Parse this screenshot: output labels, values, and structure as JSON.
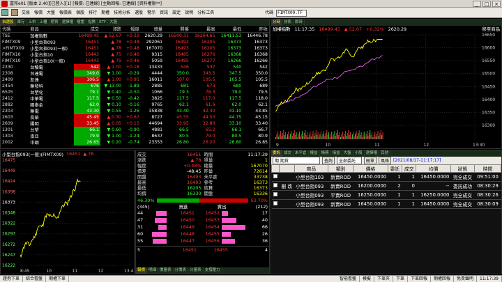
{
  "window": {
    "title": "富邦e01 [版本 2.40][已登入][1] [報價: 已連線] [主動回報: 已連線] [資料權限**]",
    "controls": [
      "_",
      "□",
      "×"
    ]
  },
  "toolbar": {
    "menus": [
      "交易",
      "報價",
      "大盤",
      "報價表",
      "個股",
      "排行",
      "期權",
      "技術分析",
      "選股",
      "警示",
      "資訊",
      "設定",
      "說明",
      "分析工具"
    ],
    "code_label": "代碼",
    "code_value": "FIMTX09.TF"
  },
  "quote_panel": {
    "tabs": [
      "自選股",
      "庫存",
      "上市",
      "上櫃",
      "期貨",
      "選擇權",
      "權證",
      "指數",
      "ETF",
      "大盤"
    ],
    "headers": [
      "代碼",
      "商品",
      "成交",
      "漲跌",
      "幅度",
      "總量",
      "開盤",
      "最高",
      "最低",
      "昨收"
    ],
    "rows": [
      {
        "code": "TSE",
        "name": "加權指數",
        "price": "16499.45",
        "chg": "▲ 52.67",
        "pct": "+0.32",
        "vol": "2620.29",
        "open": "16500.31",
        "high": "16264.65",
        "low": "16411.53",
        "ref": "16446.78",
        "dir": "up"
      },
      {
        "code": "FIMTX09",
        "name": "小型台指093",
        "price": "16451",
        "chg": "▲ 78",
        "pct": "+0.48",
        "vol": "292061",
        "open": "16493",
        "high": "16205",
        "low": "16373",
        "ref": "16373",
        "dir": "up"
      },
      {
        "code": ">FIMTX09",
        "name": "小型台指093(一般)",
        "price": "16451",
        "chg": "▲ 78",
        "pct": "+0.48",
        "vol": "167070",
        "open": "16493",
        "high": "16205",
        "low": "16373",
        "ref": "16373",
        "dir": "up"
      },
      {
        "code": "FIMTX10",
        "name": "小型台指10",
        "price": "16443",
        "chg": "▲ 75",
        "pct": "+0.46",
        "vol": "9315",
        "open": "16485",
        "high": "16276",
        "low": "16368",
        "ref": "16368",
        "dir": "up"
      },
      {
        "code": "FIMTX10",
        "name": "小型台指10(一般)",
        "price": "16443",
        "chg": "▲ 75",
        "pct": "+0.46",
        "vol": "5059",
        "open": "16485",
        "high": "16277",
        "low": "16266",
        "ref": "16266",
        "dir": "up"
      },
      {
        "code": "2330",
        "name": "台積電",
        "price": "542",
        "chg": "▲ 1.00",
        "pct": "+0.18",
        "vol": "13433",
        "open": "546",
        "high": "537",
        "low": "540",
        "ref": "542",
        "dir": "up"
      },
      {
        "code": "2308",
        "name": "台達電",
        "price": "349.0",
        "chg": "▼ 1.00",
        "pct": "-0.29",
        "vol": "4444",
        "open": "350.0",
        "high": "343.5",
        "low": "347.5",
        "ref": "350.0",
        "dir": "dn"
      },
      {
        "code": "2409",
        "name": "友達",
        "price": "106.5",
        "chg": "▲ 1.00",
        "pct": "+0.95",
        "vol": "16011",
        "open": "107.0",
        "high": "105.5",
        "low": "105.5",
        "ref": "105.5",
        "dir": "up"
      },
      {
        "code": "2454",
        "name": "聯發科",
        "price": "676",
        "chg": "▼ 13.00",
        "pct": "-1.89",
        "vol": "2885",
        "open": "681",
        "high": "673",
        "low": "680",
        "ref": "689",
        "dir": "dn"
      },
      {
        "code": "6505",
        "name": "台塑化",
        "price": "79.1",
        "chg": "▼ 0.40",
        "pct": "-0.50",
        "vol": "1066",
        "open": "79.3",
        "high": "78.3",
        "low": "79.0",
        "ref": "79.5",
        "dir": "dn"
      },
      {
        "code": "2412",
        "name": "中華電",
        "price": "117.5",
        "chg": "▼ 0.50",
        "pct": "-0.42",
        "vol": "3825",
        "open": "117.5",
        "high": "117.0",
        "low": "117.5",
        "ref": "118.0",
        "dir": "dn"
      },
      {
        "code": "2882",
        "name": "國泰金",
        "price": "62.0",
        "chg": "▼ 0.10",
        "pct": "-0.16",
        "vol": "9765",
        "open": "62.1",
        "high": "61.6",
        "low": "62.0",
        "ref": "62.1",
        "dir": "dn"
      },
      {
        "code": "2303",
        "name": "聯電",
        "price": "43.30",
        "chg": "▼ 0.55",
        "pct": "-1.26",
        "vol": "35838",
        "open": "43.40",
        "high": "42.40",
        "low": "43.10",
        "ref": "43.85",
        "dir": "dn"
      },
      {
        "code": "2603",
        "name": "長榮",
        "price": "45.45",
        "chg": "▲ 0.30",
        "pct": "+0.67",
        "vol": "8727",
        "open": "45.55",
        "high": "44.50",
        "low": "44.75",
        "ref": "45.15",
        "dir": "up"
      },
      {
        "code": "2609",
        "name": "陽明",
        "price": "33.45",
        "chg": "▲ 0.05",
        "pct": "+0.15",
        "vol": "44694",
        "open": "33.95",
        "high": "32.80",
        "low": "33.10",
        "ref": "33.40",
        "dir": "up"
      },
      {
        "code": "1301",
        "name": "台塑",
        "price": "66.1",
        "chg": "▼ 0.60",
        "pct": "-0.90",
        "vol": "4881",
        "open": "66.5",
        "high": "65.2",
        "low": "66.1",
        "ref": "66.7",
        "dir": "dn"
      },
      {
        "code": "1303",
        "name": "南亞",
        "price": "79.9",
        "chg": "▼ 1.00",
        "pct": "-1.24",
        "vol": "8637",
        "open": "80.5",
        "high": "79.0",
        "low": "80.5",
        "ref": "80.9",
        "dir": "dn"
      },
      {
        "code": "2002",
        "name": "中鋼",
        "price": "26.65",
        "chg": "▼ 0.20",
        "pct": "-0.74",
        "vol": "23353",
        "open": "26.80",
        "high": "26.20",
        "low": "26.80",
        "ref": "26.85",
        "dir": "dn"
      }
    ]
  },
  "index_chart": {
    "tabs": [
      "分時",
      "技術",
      "即時"
    ],
    "name": "加權指數",
    "time": "11:17:35",
    "price": "16499.45",
    "chg": "▲ 52.67",
    "pct": "+0.32%",
    "vol": "2620.29",
    "corner": "移至商品",
    "y_ticks": [
      "16650",
      "16600",
      "16550",
      "16500",
      "16450",
      "16400",
      "16350",
      "16300"
    ],
    "x_ticks": [
      "9",
      "10",
      "11",
      "12",
      "13:30"
    ]
  },
  "futures_chart": {
    "title": "小型台指093(一般)(FIMTX09)",
    "price": "16451",
    "chg": "▲ 78",
    "y_ticks": [
      "16475",
      "16449",
      "16424",
      "16398",
      "16373",
      "16348",
      "16322",
      "16297",
      "16272",
      "16247",
      "16222"
    ],
    "x_ticks": [
      "8:45",
      "10",
      "11",
      "12",
      "13:45"
    ]
  },
  "detail_panel": {
    "tabs": [
      "報價",
      "明細",
      "價量表",
      "分價表",
      "分量表",
      "支撐壓力"
    ],
    "left": [
      {
        "k": "成交",
        "v": "16451",
        "c": "up"
      },
      {
        "k": "漲跌",
        "v": "▲ 78",
        "c": "up"
      },
      {
        "k": "幅度",
        "v": "+0.48%",
        "c": "up"
      },
      {
        "k": "價差",
        "v": "-48.45",
        "c": "wh"
      },
      {
        "k": "開盤",
        "v": "16493",
        "c": "up"
      },
      {
        "k": "最高",
        "v": "16493",
        "c": "up"
      },
      {
        "k": "最低",
        "v": "16205",
        "c": "dn"
      },
      {
        "k": "均價",
        "v": "16330",
        "c": "dn"
      }
    ],
    "right": [
      {
        "k": "時間",
        "v": "11:17:39",
        "c": "wh"
      },
      {
        "k": "單量",
        "v": "1",
        "c": "fl"
      },
      {
        "k": "總量",
        "v": "167070",
        "c": "fl"
      },
      {
        "k": "昨量",
        "v": "72614",
        "c": "fl"
      },
      {
        "k": "未平倉",
        "v": "33738",
        "c": "fl"
      },
      {
        "k": "參考",
        "v": "16373",
        "c": "fl"
      },
      {
        "k": "結算",
        "v": "16373",
        "c": "fl"
      },
      {
        "k": "開盤",
        "v": "16336",
        "c": "fl"
      }
    ],
    "ratio_left": "46.30%",
    "ratio_right": "53.70%",
    "ratio_fill": 0.463,
    "bid_total": "(345)",
    "ask_total": "(212)",
    "book_headers": [
      "買進",
      "賣出"
    ],
    "book": [
      {
        "bq": "44",
        "bp": "16451",
        "ap": "16452",
        "aq": "17",
        "bw": 0.55
      },
      {
        "bq": "47",
        "bp": "16450",
        "ap": "16453",
        "aq": "40",
        "bw": 0.6
      },
      {
        "bq": "31",
        "bp": "16449",
        "ap": "16454",
        "aq": "66",
        "bw": 0.42
      },
      {
        "bq": "60",
        "bp": "16448",
        "ap": "16455",
        "aq": "26",
        "bw": 0.75
      },
      {
        "bq": "55",
        "bp": "16447",
        "ap": "16456",
        "aq": "36",
        "bw": 0.7
      }
    ],
    "book_foot": {
      "l": "5",
      "lp": "16451",
      "rp": "16455",
      "r": "4"
    }
  },
  "orders_panel": {
    "tabs": [
      "委託",
      "成交",
      "未平倉",
      "權益",
      "帳務",
      "損益",
      "大盤",
      "小股",
      "選擇權",
      "其他"
    ],
    "account": "期 期貨",
    "query_label": "查詢",
    "filter": "全部委託",
    "delete_label": "刪單",
    "style_label": "風格",
    "datetime": "[2021/08/17-11:17:17]",
    "headers": [
      "",
      "",
      "商品",
      "類別",
      "價格",
      "委託",
      "成交",
      "均價",
      "狀態",
      "時間"
    ],
    "rows": [
      {
        "act": "",
        "name": "小型台指103",
        "type": "新賣ROD",
        "price": "16450.0000",
        "ord": "1",
        "fill": "1",
        "avg": "16450.0000",
        "status": "完全成交",
        "time": "09:51:00",
        "tc": "dn"
      },
      {
        "act": "刪 改",
        "name": "小型台指093",
        "type": "新賣ROD",
        "price": "16200.0000",
        "ord": "2",
        "fill": "0",
        "avg": "--",
        "status": "委託成功",
        "time": "08:30:29",
        "tc": "dn"
      },
      {
        "act": "",
        "name": "小型台指093",
        "type": "平賣ROD",
        "price": "16250.0000",
        "ord": "1",
        "fill": "1",
        "avg": "16250.0000",
        "status": "完全成交",
        "time": "08:30:26",
        "tc": "dn"
      },
      {
        "act": "",
        "name": "小型台指093",
        "type": "新賣ROD",
        "price": "16450.0000",
        "ord": "1",
        "fill": "1",
        "avg": "16450.0000",
        "status": "完全成交",
        "time": "08:30:09",
        "tc": "dn"
      }
    ]
  },
  "statusbar": {
    "items": [
      "證券下單",
      "綜合看盤",
      "期權下單"
    ],
    "right": [
      "智能看盤",
      "模擬",
      "下單夾",
      "下單",
      "下單回報",
      "期權回報",
      "免責聲明",
      "11:17:39"
    ]
  },
  "colors": {
    "up": "#ff3333",
    "down": "#33ff33",
    "flat": "#ffff00",
    "line": "#ffff00",
    "avg": "#ff66ff",
    "accent": "#0ff"
  }
}
